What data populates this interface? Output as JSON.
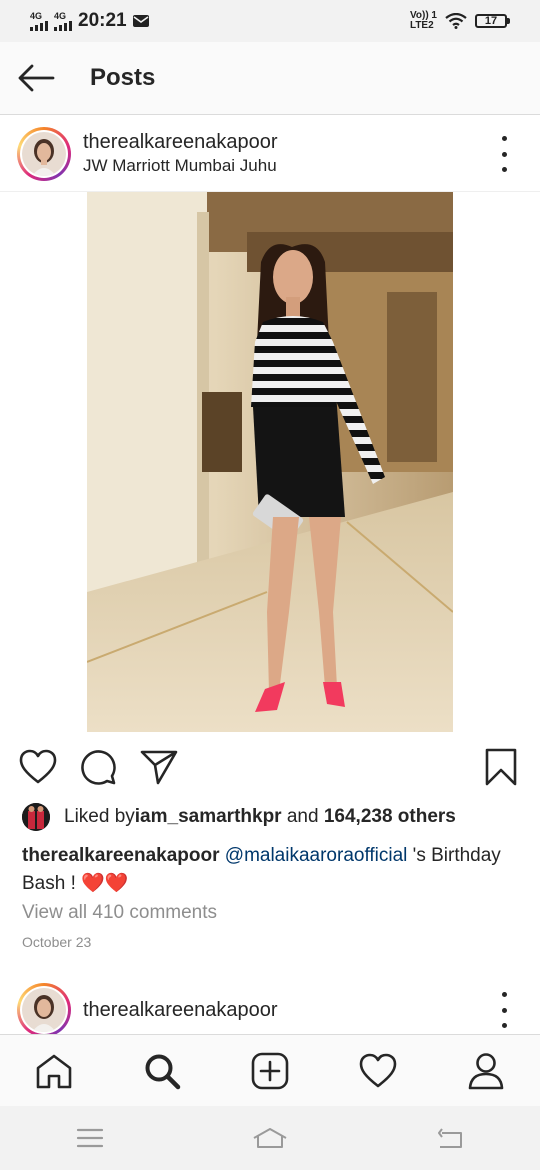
{
  "status_bar": {
    "network_1": "4G",
    "network_2": "4G",
    "time": "20:21",
    "volte_top": "Vo)) 1",
    "volte_bottom": "LTE2",
    "battery": "17"
  },
  "header": {
    "title": "Posts"
  },
  "post": {
    "username": "therealkareenakapoor",
    "location": "JW Marriott Mumbai Juhu",
    "liked_by_prefix": "Liked by ",
    "liked_by_user": "iam_samarthkpr",
    "liked_by_and": " and ",
    "liked_by_count": "164,238 others",
    "caption_user": "therealkareenakapoor",
    "caption_mention": "@malaikaarora​official",
    "caption_text": " 's Birthday Bash ! ❤️❤️",
    "view_comments": "View all 410 comments",
    "date": "October 23"
  },
  "next_post": {
    "username": "therealkareenakapoor"
  },
  "icons": {
    "back": "arrow-left-icon",
    "more": "more-vertical-icon",
    "like": "heart-icon",
    "comment": "comment-icon",
    "share": "send-icon",
    "save": "bookmark-icon",
    "home": "home-icon",
    "search": "search-icon",
    "new_post": "add-post-icon",
    "activity": "heart-icon",
    "profile": "profile-icon"
  },
  "colors": {
    "like_red": "#e0245e",
    "mention_blue": "#00376b",
    "muted": "#8e8e8e"
  }
}
